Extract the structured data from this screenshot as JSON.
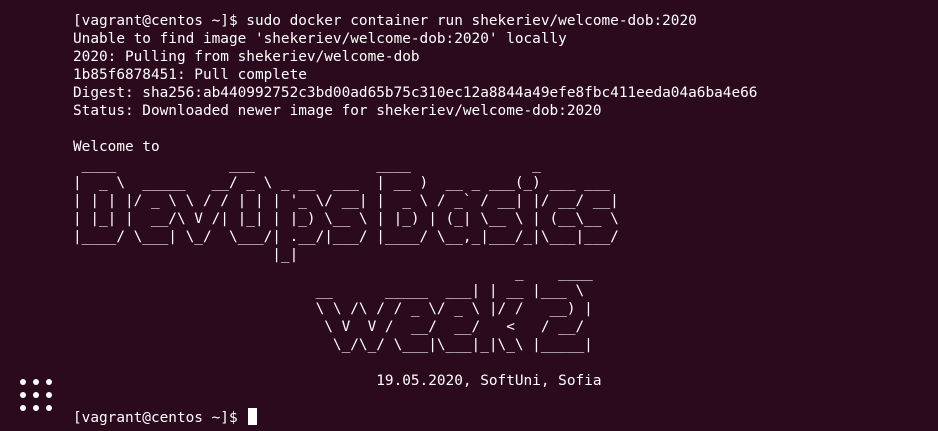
{
  "dock": {
    "apps_button_icon": "grid-dots-icon"
  },
  "terminal": {
    "lines": [
      "[vagrant@centos ~]$ sudo docker container run shekeriev/welcome-dob:2020",
      "Unable to find image 'shekeriev/welcome-dob:2020' locally",
      "2020: Pulling from shekeriev/welcome-dob",
      "1b85f6878451: Pull complete",
      "Digest: sha256:ab440992752c3bd00ad65b75c310ec12a8844a49efe8fbc411eeda04a6ba4e66",
      "Status: Downloaded newer image for shekeriev/welcome-dob:2020",
      "",
      "Welcome to"
    ],
    "ascii_art": " ____             ___              ____              _\n|  _ \\  _____   __/ _ \\ _ __  ___  | __ )  __ _ ___(_) ___ ___\n| | | |/ _ \\ \\ / / | | | '_ \\/ __| |  _ \\ / _` / __| |/ __/ __|\n| |_| |  __/\\ V /| |_| | |_) \\__ \\ | |_) | (_| \\__ \\ | (__\\__ \\\n|____/ \\___| \\_/  \\___/| .__/|___/ |____/ \\__,_|___/_|\\___|___/\n                       |_|\n                                                   _    ____\n                            __      _____  ___| | __ |___ \\\n                            \\ \\ /\\ / / _ \\/ _ \\ |/ /   __) |\n                             \\ V  V /  __/  __/   <   / __/\n                              \\_/\\_/ \\___|\\___|_|\\_\\ |_____|",
    "footer": "                                   19.05.2020, SoftUni, Sofia",
    "prompt": "[vagrant@centos ~]$ "
  }
}
